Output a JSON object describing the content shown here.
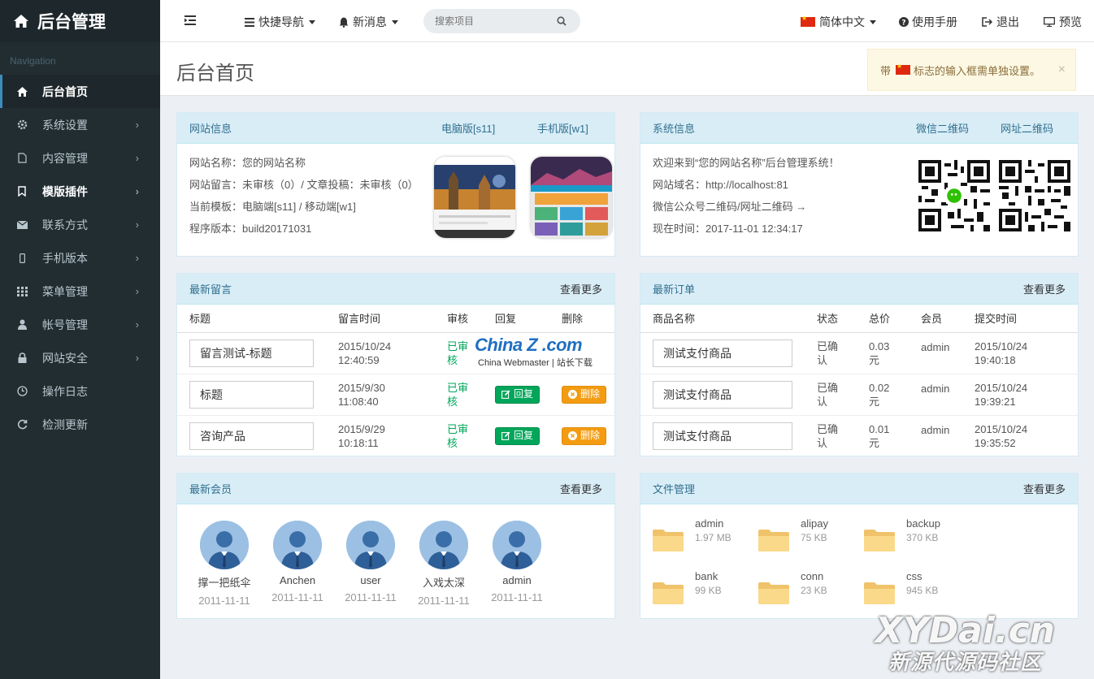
{
  "brand": {
    "title": "后台管理"
  },
  "sidebar": {
    "header": "Navigation",
    "items": [
      {
        "label": "后台首页",
        "icon": "home-icon"
      },
      {
        "label": "系统设置",
        "icon": "gear-icon"
      },
      {
        "label": "内容管理",
        "icon": "file-icon"
      },
      {
        "label": "模版插件",
        "icon": "bookmark-icon"
      },
      {
        "label": "联系方式",
        "icon": "envelope-icon"
      },
      {
        "label": "手机版本",
        "icon": "mobile-icon"
      },
      {
        "label": "菜单管理",
        "icon": "grid-icon"
      },
      {
        "label": "帐号管理",
        "icon": "user-icon"
      },
      {
        "label": "网站安全",
        "icon": "lock-icon"
      },
      {
        "label": "操作日志",
        "icon": "clock-icon"
      },
      {
        "label": "检测更新",
        "icon": "refresh-icon"
      }
    ]
  },
  "topbar": {
    "quick_nav": "快捷导航",
    "messages": "新消息",
    "search_placeholder": "搜索项目",
    "language": "简体中文",
    "manual": "使用手册",
    "logout": "退出",
    "preview": "预览"
  },
  "page": {
    "title": "后台首页",
    "alert_prefix": "带",
    "alert_suffix": "标志的输入框需单独设置。",
    "alert_close": "×"
  },
  "site_info": {
    "title": "网站信息",
    "pc_label": "电脑版[s11]",
    "mobile_label": "手机版[w1]",
    "lines": [
      "网站名称：您的网站名称",
      "网站留言：未审核（0）/ 文章投稿：未审核（0）",
      "当前模板：电脑端[s11] / 移动端[w1]",
      "程序版本：build20171031"
    ]
  },
  "sys_info": {
    "title": "系统信息",
    "wechat_qr": "微信二维码",
    "url_qr": "网址二维码",
    "lines": [
      "欢迎来到“您的网站名称”后台管理系统！",
      "网站域名：http://localhost:81",
      "微信公众号二维码/网址二维码 →",
      "现在时间：2017-11-01 12:34:17"
    ]
  },
  "messages": {
    "title": "最新留言",
    "more": "查看更多",
    "columns": [
      "标题",
      "留言时间",
      "审核",
      "回复",
      "删除"
    ],
    "rows": [
      {
        "title": "留言测试-标题",
        "time1": "2015/10/24",
        "time2": "12:40:59",
        "status1": "已审",
        "status2": "核"
      },
      {
        "title": "标题",
        "time1": "2015/9/30",
        "time2": "11:08:40",
        "status1": "已审",
        "status2": "核",
        "reply": "回复",
        "delete": "删除"
      },
      {
        "title": "咨询产品",
        "time1": "2015/9/29",
        "time2": "10:18:11",
        "status1": "已审",
        "status2": "核",
        "reply": "回复",
        "delete": "删除"
      }
    ]
  },
  "orders": {
    "title": "最新订单",
    "more": "查看更多",
    "columns": [
      "商品名称",
      "状态",
      "总价",
      "会员",
      "提交时间"
    ],
    "rows": [
      {
        "name": "测试支付商品",
        "s1": "已确",
        "s2": "认",
        "p1": "0.03",
        "p2": "元",
        "member": "admin",
        "t1": "2015/10/24",
        "t2": "19:40:18"
      },
      {
        "name": "测试支付商品",
        "s1": "已确",
        "s2": "认",
        "p1": "0.02",
        "p2": "元",
        "member": "admin",
        "t1": "2015/10/24",
        "t2": "19:39:21"
      },
      {
        "name": "测试支付商品",
        "s1": "已确",
        "s2": "认",
        "p1": "0.01",
        "p2": "元",
        "member": "admin",
        "t1": "2015/10/24",
        "t2": "19:35:52"
      }
    ]
  },
  "members": {
    "title": "最新会员",
    "more": "查看更多",
    "items": [
      {
        "name": "撑一把纸伞",
        "date": "2011-11-11"
      },
      {
        "name": "Anchen",
        "date": "2011-11-11"
      },
      {
        "name": "user",
        "date": "2011-11-11"
      },
      {
        "name": "入戏太深",
        "date": "2011-11-11"
      },
      {
        "name": "admin",
        "date": "2011-11-11"
      }
    ]
  },
  "files": {
    "title": "文件管理",
    "more": "查看更多",
    "items": [
      {
        "name": "admin",
        "size": "1.97 MB"
      },
      {
        "name": "alipay",
        "size": "75 KB"
      },
      {
        "name": "backup",
        "size": "370 KB"
      },
      {
        "name": "bank",
        "size": "99 KB"
      },
      {
        "name": "conn",
        "size": "23 KB"
      },
      {
        "name": "css",
        "size": "945 KB"
      }
    ]
  },
  "watermarks": {
    "chinaz_logo": "China Z .com",
    "chinaz_sub": "China Webmaster",
    "chinaz_sub2": "站长下载",
    "xydai_logo": "XYDai.cn",
    "xydai_sub": "新源代源码社区"
  },
  "colors": {
    "sidebar": "#222d32",
    "accent": "#3c8dbc",
    "panel_head": "#d9edf7",
    "success": "#00a65a",
    "warning": "#f39c12"
  }
}
